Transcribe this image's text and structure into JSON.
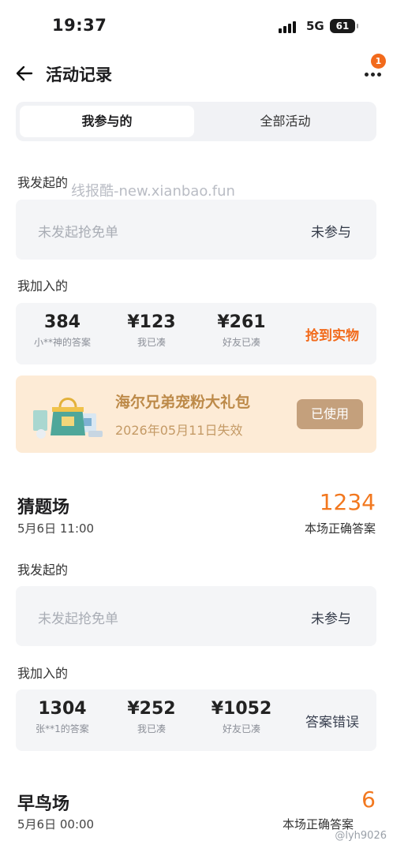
{
  "status_bar": {
    "time": "19:37",
    "network": "5G",
    "battery": "61"
  },
  "nav": {
    "title": "活动记录",
    "badge": "1"
  },
  "tabs": {
    "mine": "我参与的",
    "all": "全部活动"
  },
  "watermark": "线报酷-new.xianbao.fun",
  "sections": [
    {
      "launched_label": "我发起的",
      "launched_placeholder": "未发起抢免单",
      "launched_status": "未参与",
      "joined_label": "我加入的",
      "stats": [
        {
          "value": "384",
          "caption": "小**神的答案"
        },
        {
          "value": "¥123",
          "caption": "我已凑"
        },
        {
          "value": "¥261",
          "caption": "好友已凑"
        }
      ],
      "result": "抢到实物",
      "prize": {
        "name": "海尔兄弟宠粉大礼包",
        "expire": "2026年05月11日失效",
        "button": "已使用"
      }
    },
    {
      "round_title": "猜题场",
      "round_time": "5月6日 11:00",
      "correct_count": "1234",
      "correct_label": "本场正确答案",
      "launched_label": "我发起的",
      "launched_placeholder": "未发起抢免单",
      "launched_status": "未参与",
      "joined_label": "我加入的",
      "stats": [
        {
          "value": "1304",
          "caption": "张**1的答案"
        },
        {
          "value": "¥252",
          "caption": "我已凑"
        },
        {
          "value": "¥1052",
          "caption": "好友已凑"
        }
      ],
      "result": "答案错误"
    },
    {
      "round_title": "早鸟场",
      "round_time": "5月6日 00:00",
      "correct_count": "6",
      "correct_label": "本场正确答案"
    }
  ],
  "footer_watermark": "@lyh9026",
  "colors": {
    "accent_orange": "#f2781f",
    "result_orange": "#f26a1b",
    "wrong_gray": "#3b4252",
    "prize_bg": "#fdebd6"
  }
}
